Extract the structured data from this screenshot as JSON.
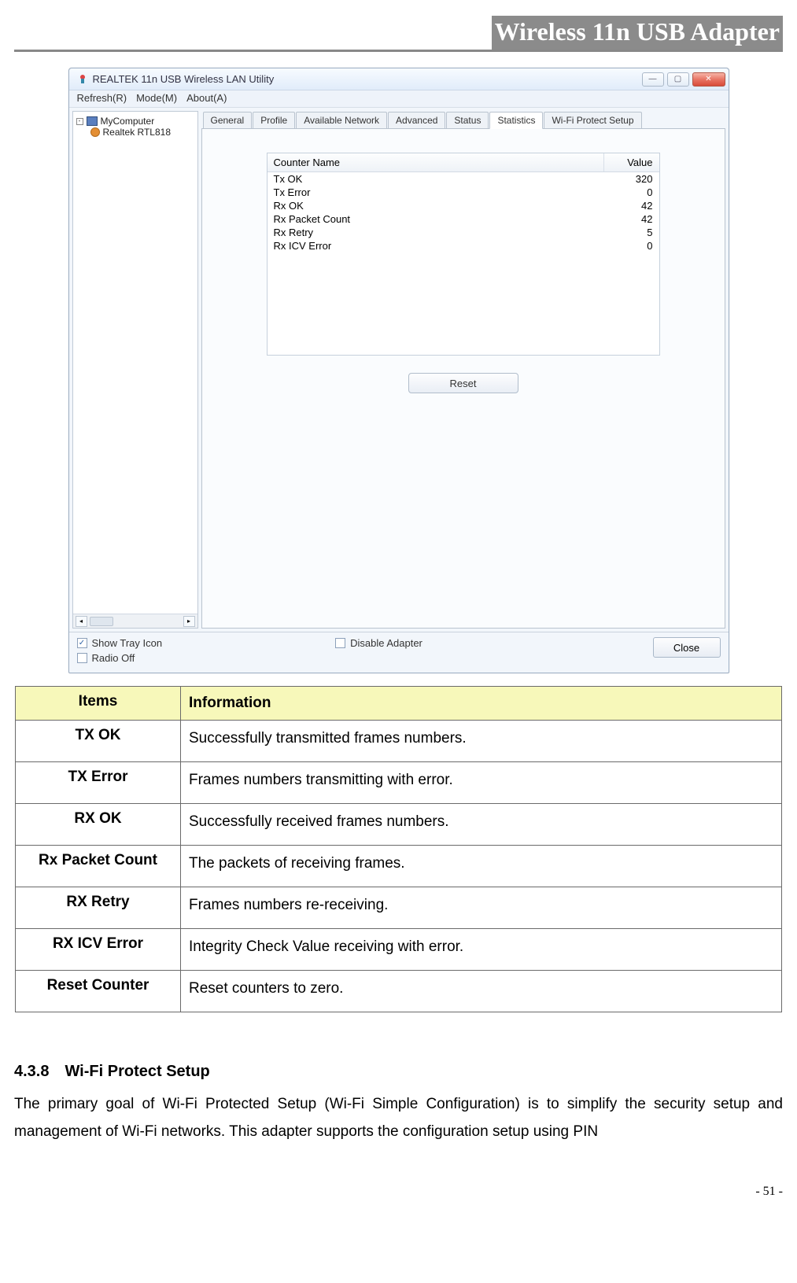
{
  "header": {
    "title": "Wireless 11n USB Adapter"
  },
  "window": {
    "title": "REALTEK 11n USB Wireless LAN Utility",
    "menus": {
      "refresh": "Refresh(R)",
      "mode": "Mode(M)",
      "about": "About(A)"
    },
    "tree": {
      "root": "MyComputer",
      "child": "Realtek RTL818"
    },
    "tabs": [
      "General",
      "Profile",
      "Available Network",
      "Advanced",
      "Status",
      "Statistics",
      "Wi-Fi Protect Setup"
    ],
    "tabs_active_index": 5,
    "stats_head": {
      "name": "Counter Name",
      "value": "Value"
    },
    "stats": [
      {
        "name": "Tx OK",
        "value": "320"
      },
      {
        "name": "Tx Error",
        "value": "0"
      },
      {
        "name": "Rx OK",
        "value": "42"
      },
      {
        "name": "Rx Packet Count",
        "value": "42"
      },
      {
        "name": "Rx Retry",
        "value": "5"
      },
      {
        "name": "Rx ICV Error",
        "value": "0"
      }
    ],
    "reset_label": "Reset",
    "bottom": {
      "show_tray": "Show Tray Icon",
      "radio_off": "Radio Off",
      "disable_adapter": "Disable Adapter",
      "close": "Close"
    }
  },
  "info_table": {
    "head_left": "Items",
    "head_right": "Information",
    "rows": [
      {
        "item": "TX OK",
        "info": "Successfully transmitted frames numbers."
      },
      {
        "item": "TX Error",
        "info": "Frames numbers transmitting with error."
      },
      {
        "item": "RX OK",
        "info": "Successfully received frames numbers."
      },
      {
        "item": "Rx Packet Count",
        "info": "The packets of receiving frames."
      },
      {
        "item": "RX Retry",
        "info": "Frames numbers re-receiving."
      },
      {
        "item": "RX ICV Error",
        "info": "Integrity Check Value receiving with error."
      },
      {
        "item": "Reset Counter",
        "info": "Reset counters to zero."
      }
    ]
  },
  "section": {
    "number": "4.3.8",
    "title": "Wi-Fi Protect Setup",
    "body": "The primary goal of Wi-Fi Protected Setup (Wi-Fi Simple Configuration) is to simplify the security setup and management of Wi-Fi networks. This adapter supports the configuration setup using PIN"
  },
  "page_number": "- 51 -"
}
